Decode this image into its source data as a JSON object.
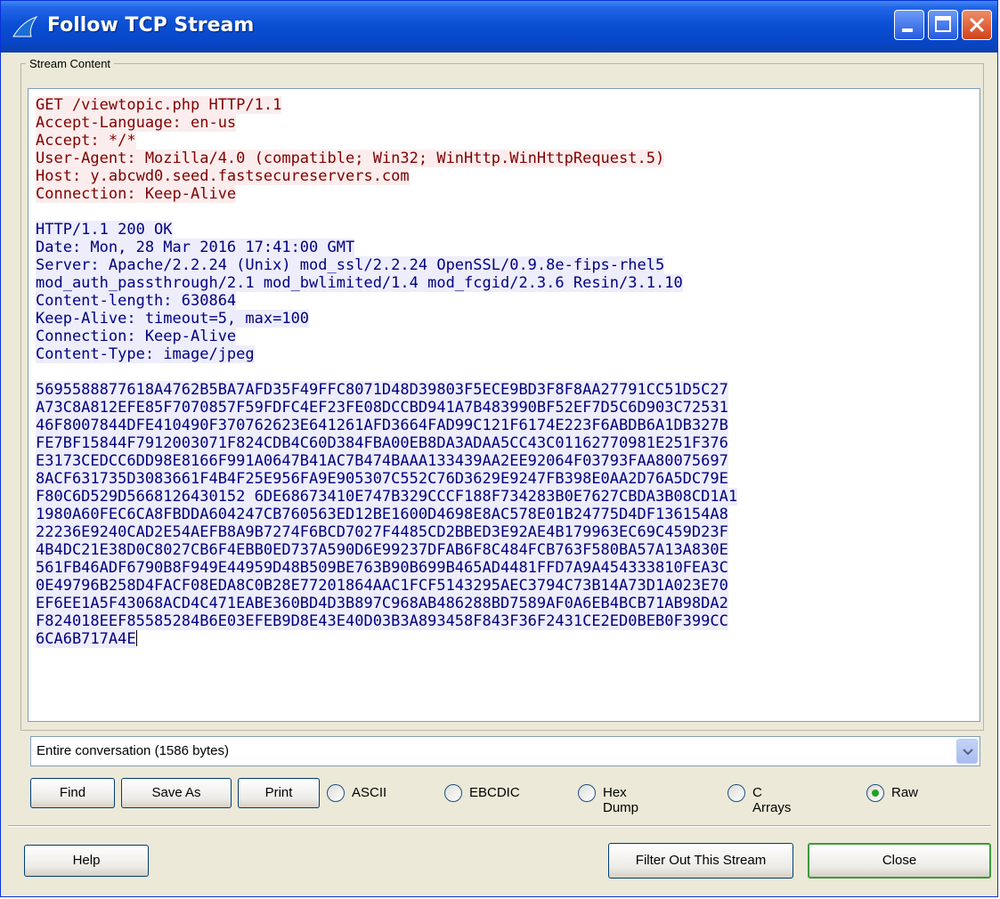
{
  "window": {
    "title": "Follow TCP Stream",
    "accent": "#0a4fd4"
  },
  "stream": {
    "group_label": "Stream Content",
    "request_lines": [
      "GET /viewtopic.php HTTP/1.1",
      "Accept-Language: en-us",
      "Accept: */*",
      "User-Agent: Mozilla/4.0 (compatible; Win32; WinHttp.WinHttpRequest.5)",
      "Host: y.abcwd0.seed.fastsecureservers.com",
      "Connection: Keep-Alive"
    ],
    "response_lines": [
      "HTTP/1.1 200 OK",
      "Date: Mon, 28 Mar 2016 17:41:00 GMT",
      "Server: Apache/2.2.24 (Unix) mod_ssl/2.2.24 OpenSSL/0.9.8e-fips-rhel5",
      "mod_auth_passthrough/2.1 mod_bwlimited/1.4 mod_fcgid/2.3.6 Resin/3.1.10",
      "Content-length: 630864",
      "Keep-Alive: timeout=5, max=100",
      "Connection: Keep-Alive",
      "Content-Type: image/jpeg"
    ],
    "hex_lines": [
      "5695588877618A4762B5BA7AFD35F49FFC8071D48D39803F5ECE9BD3F8F8AA27791CC51D5C27",
      "A73C8A812EFE85F7070857F59FDFC4EF23FE08DCCBD941A7B483990BF52EF7D5C6D903C72531",
      "46F8007844DFE410490F370762623E641261AFD3664FAD99C121F6174E223F6ABDB6A1DB327B",
      "FE7BF15844F7912003071F824CDB4C60D384FBA00EB8DA3ADAA5CC43C01162770981E251F376",
      "E3173CEDCC6DD98E8166F991A0647B41AC7B474BAAA133439AA2EE92064F03793FAA80075697",
      "8ACF631735D3083661F4B4F25E956FA9E905307C552C76D3629E9247FB398E0AA2D76A5DC79E",
      "F80C6D529D5668126430152 6DE68673410E747B329CCCF188F734283B0E7627CBDA3B08CD1A1",
      "1980A60FEC6CA8FBDDA604247CB760563ED12BE1600D4698E8AC578E01B24775D4DF136154A8",
      "22236E9240CAD2E54AEFB8A9B7274F6BCD7027F4485CD2BBED3E92AE4B179963EC69C459D23F",
      "4B4DC21E38D0C8027CB6F4EBB0ED737A590D6E99237DFAB6F8C484FCB763F580BA57A13A830E",
      "561FB46ADF6790B8F949E44959D48B509BE763B90B699B465AD4481FFD7A9A454333810FEA3C",
      "0E49796B258D4FACF08EDA8C0B28E77201864AAC1FCF5143295AEC3794C73B14A73D1A023E70",
      "EF6EE1A5F43068ACD4C471EABE360BD4D3B897C968AB486288BD7589AF0A6EB4BCB71AB98DA2",
      "F824018EEF85585284B6E03EFEB9D8E43E40D03B3A893458F843F36F2431CE2ED0BEB0F399CC",
      "6CA6B717A4E"
    ],
    "request_color": "#800000",
    "response_color": "#000080"
  },
  "conversation_select": {
    "value": "Entire conversation (1586 bytes)"
  },
  "buttons": {
    "find": "Find",
    "save_as": "Save As",
    "print": "Print",
    "help": "Help",
    "filter_out": "Filter Out This Stream",
    "close": "Close"
  },
  "format_options": [
    {
      "label": "ASCII",
      "selected": false
    },
    {
      "label": "EBCDIC",
      "selected": false
    },
    {
      "label": "Hex Dump",
      "selected": false
    },
    {
      "label": "C Arrays",
      "selected": false
    },
    {
      "label": "Raw",
      "selected": true
    }
  ]
}
